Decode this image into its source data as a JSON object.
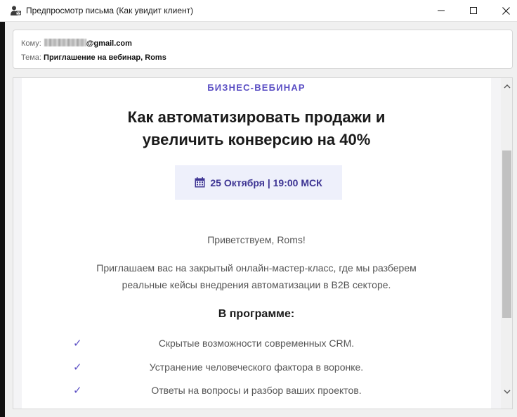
{
  "window": {
    "title": "Предпросмотр письма (Как увидит клиент)",
    "icon": "person-mail-icon"
  },
  "header": {
    "to_label": "Кому:",
    "to_value": "@gmail.com",
    "subject_label": "Тема:",
    "subject_value": "Приглашение на вебинар, Roms"
  },
  "email": {
    "kicker": "БИЗНЕС-ВЕБИНАР",
    "headline_line1": "Как автоматизировать продажи и",
    "headline_line2": "увеличить конверсию на 40%",
    "date": "25 Октября | 19:00 МСК",
    "greeting": "Приветствуем, Roms!",
    "intro_line1": "Приглашаем вас на закрытый онлайн-мастер-класс, где мы разберем",
    "intro_line2": "реальные кейсы внедрения автоматизации в B2B секторе.",
    "program_title": "В программе:",
    "check_glyph": "✓",
    "program_items": [
      "Скрытые возможности современных CRM.",
      "Устранение человеческого фактора в воронке.",
      "Ответы на вопросы и разбор ваших проектов."
    ]
  },
  "colors": {
    "accent": "#5b4fc4",
    "date_text": "#3d3493",
    "date_bg": "#eef0fb"
  }
}
